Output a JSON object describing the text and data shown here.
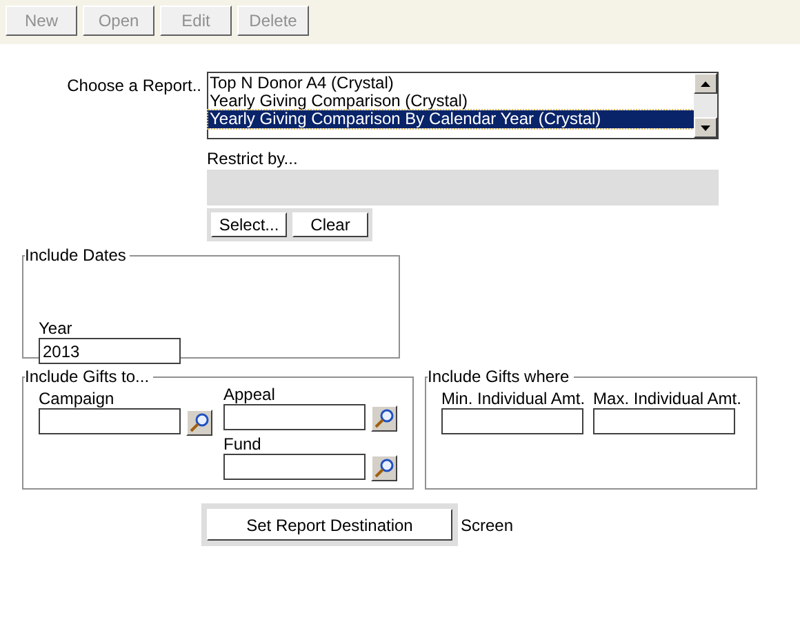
{
  "toolbar": [
    {
      "label": "New",
      "disabled": true
    },
    {
      "label": "Open",
      "disabled": true
    },
    {
      "label": "Edit",
      "disabled": true
    },
    {
      "label": "Delete",
      "disabled": true
    }
  ],
  "report": {
    "label": "Choose a Report..",
    "options": [
      {
        "label": "Top N Donor A4 (Crystal)",
        "selected": false
      },
      {
        "label": "Yearly Giving Comparison (Crystal)",
        "selected": false
      },
      {
        "label": "Yearly Giving Comparison By Calendar Year (Crystal)",
        "selected": true
      }
    ]
  },
  "restrict": {
    "label": "Restrict by...",
    "buttons": [
      "Select...",
      "Clear"
    ]
  },
  "include_dates": {
    "title": "Include Dates",
    "year_label": "Year",
    "year_value": "2013"
  },
  "include_gifts_to": {
    "title": "Include Gifts to...",
    "fields": [
      "Campaign",
      "Appeal",
      "Fund"
    ]
  },
  "include_gifts_where": {
    "title": "Include Gifts where",
    "fields": [
      "Min. Individual Amt.",
      "Max. Individual Amt."
    ]
  },
  "destination": {
    "button": "Set Report Destination",
    "value": "Screen"
  }
}
